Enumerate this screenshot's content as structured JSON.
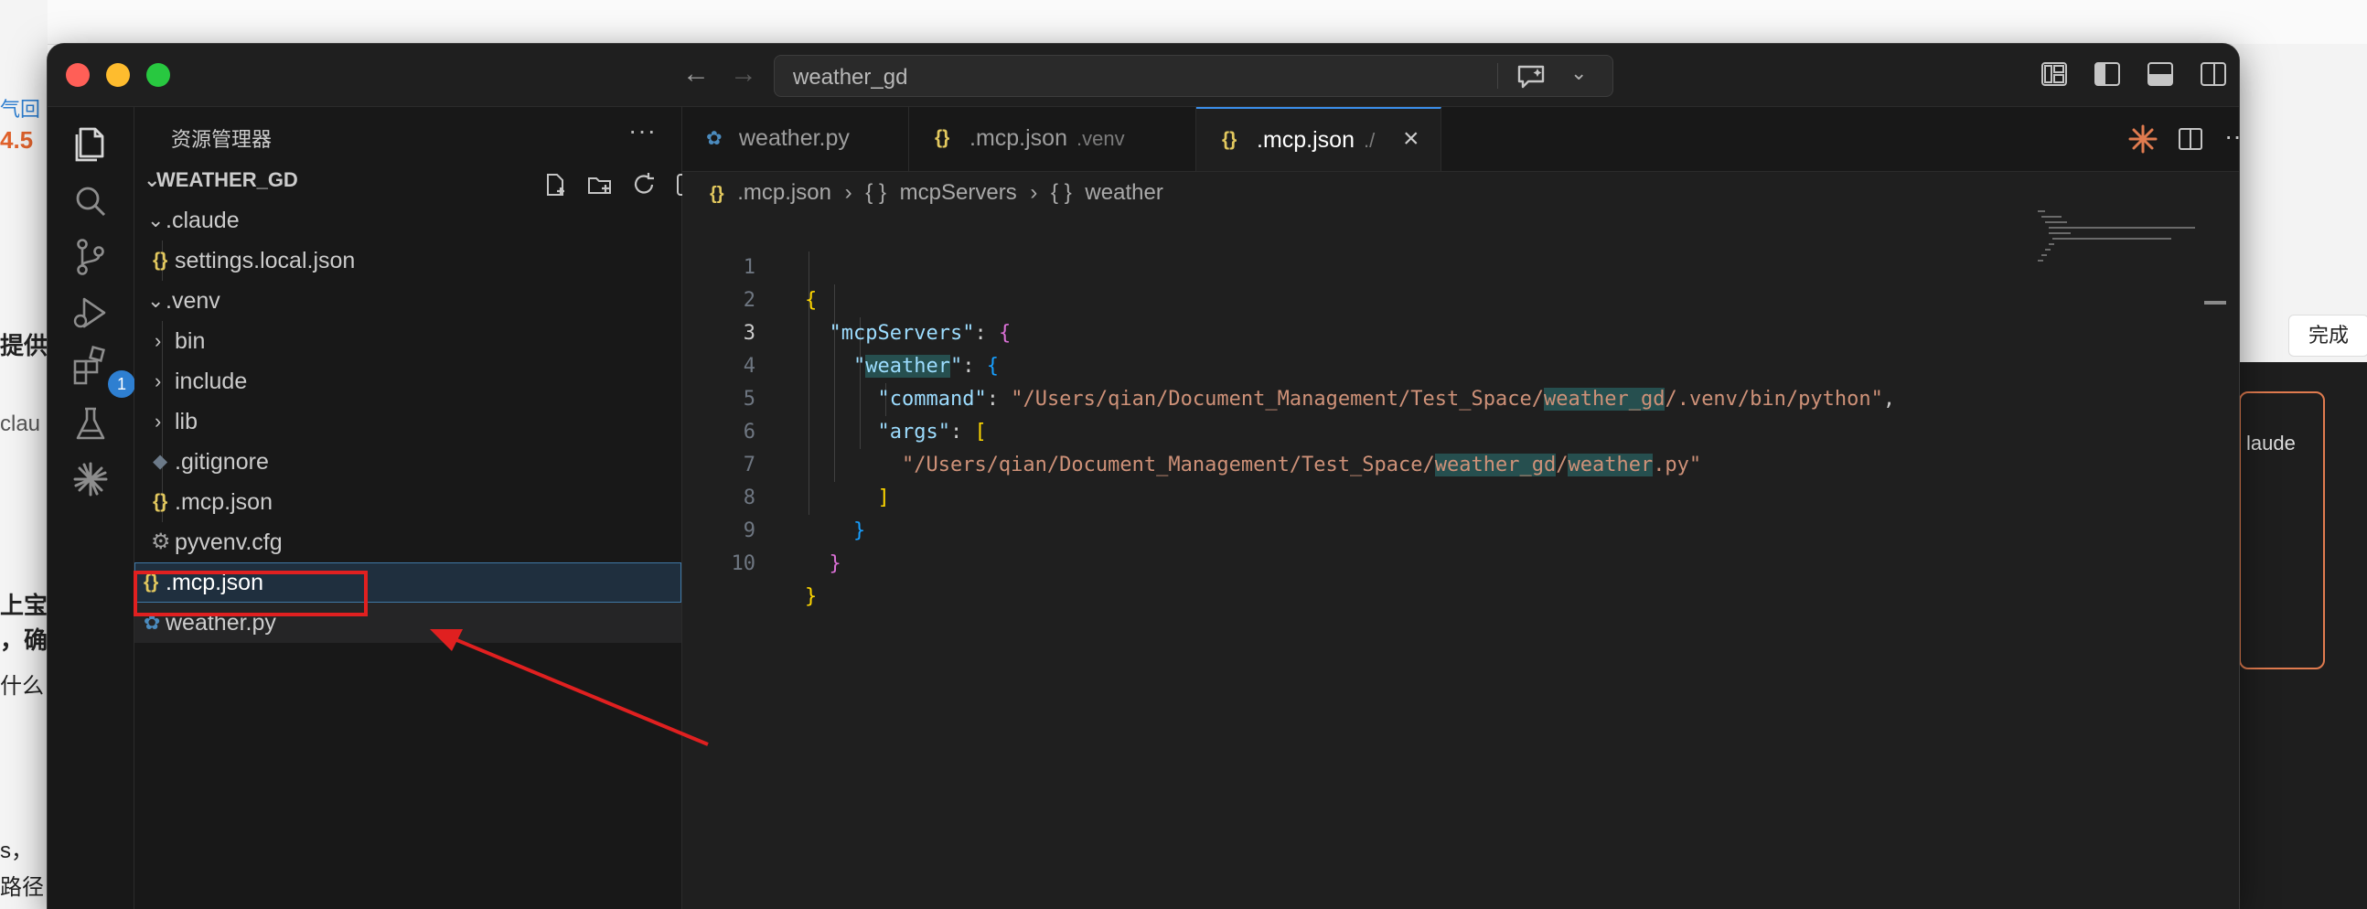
{
  "background": {
    "left_texts": [
      "气回",
      "4.5",
      "提供",
      "clau",
      "上宝",
      "，确",
      "什么",
      "s，",
      "路径"
    ],
    "right_done": "完成",
    "right_claude": "laude"
  },
  "titlebar": {
    "search_text": "weather_gd"
  },
  "activity": {
    "extensions_badge": "1"
  },
  "sidebar": {
    "title": "资源管理器",
    "more": "···",
    "root": "WEATHER_GD",
    "items": [
      {
        "label": ".claude",
        "type": "folder-open"
      },
      {
        "label": "settings.local.json",
        "type": "json"
      },
      {
        "label": ".venv",
        "type": "folder-open"
      },
      {
        "label": "bin",
        "type": "folder"
      },
      {
        "label": "include",
        "type": "folder"
      },
      {
        "label": "lib",
        "type": "folder"
      },
      {
        "label": ".gitignore",
        "type": "git"
      },
      {
        "label": ".mcp.json",
        "type": "json"
      },
      {
        "label": "pyvenv.cfg",
        "type": "gear"
      },
      {
        "label": ".mcp.json",
        "type": "json"
      },
      {
        "label": "weather.py",
        "type": "python"
      }
    ]
  },
  "tabs": [
    {
      "label": "weather.py",
      "desc": "",
      "icon": "python-icon"
    },
    {
      "label": ".mcp.json",
      "desc": ".venv",
      "icon": "json-icon"
    },
    {
      "label": ".mcp.json",
      "desc": "./",
      "icon": "json-icon",
      "active": true
    }
  ],
  "breadcrumb": {
    "file": ".mcp.json",
    "seg1": "mcpServers",
    "seg2": "weather"
  },
  "code": {
    "line_numbers": [
      "1",
      "2",
      "3",
      "4",
      "5",
      "6",
      "7",
      "8",
      "9",
      "10"
    ],
    "key_mcpServers": "\"mcpServers\"",
    "key_weather": "weather",
    "key_command": "\"command\"",
    "val_command_a": "\"/Users/qian/Document_Management/Test_Space/",
    "val_command_b": "weather_gd",
    "val_command_c": "/.venv/bin/python\"",
    "key_args": "\"args\"",
    "val_args_a": "\"/Users/qian/Document_Management/Test_Space/",
    "val_args_b": "weather_gd",
    "val_args_c": "/",
    "val_args_d": "weather",
    "val_args_e": ".py\""
  },
  "colors": {
    "accent": "#3b8eea",
    "json_icon": "#e2c85e",
    "highlight_red": "#e02020",
    "editor_bg": "#1f1f1f"
  }
}
